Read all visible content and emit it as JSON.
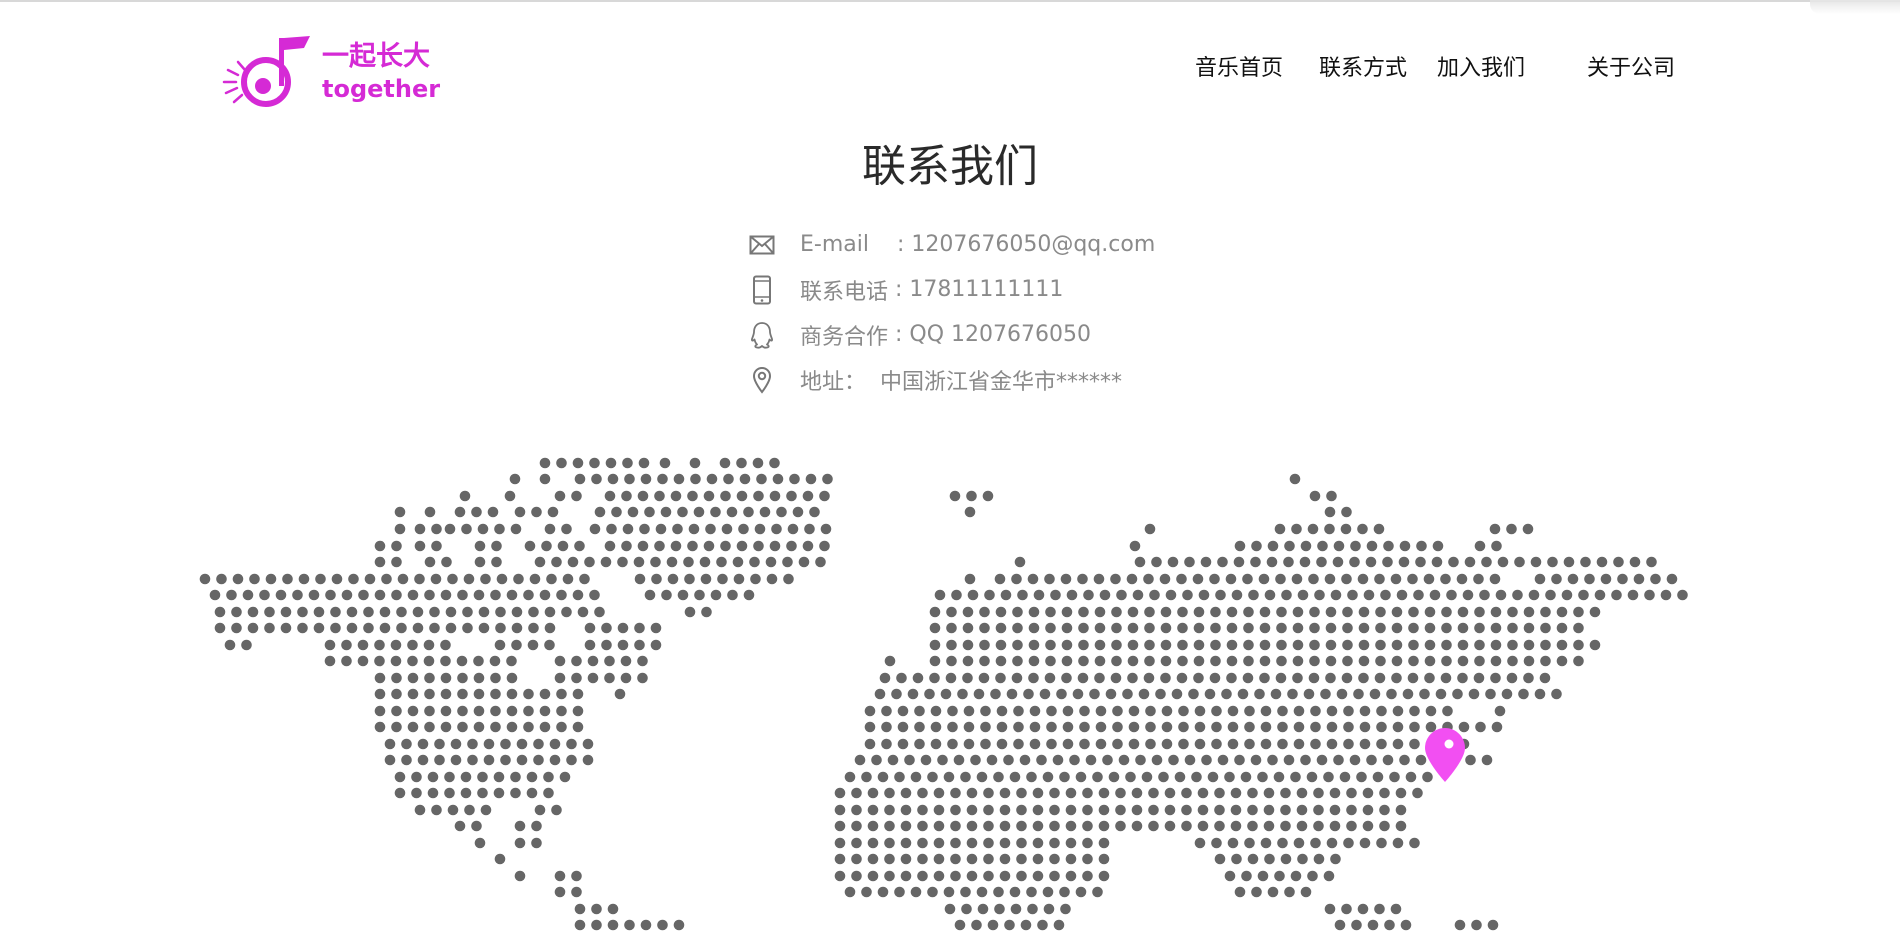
{
  "brand": {
    "name_cn": "一起长大",
    "name_en": "together",
    "color": "#d52ad5"
  },
  "nav": {
    "items": [
      {
        "label": "音乐首页"
      },
      {
        "label": "联系方式"
      },
      {
        "label": "加入我们"
      },
      {
        "label": "关于公司"
      }
    ]
  },
  "page": {
    "title": "联系我们"
  },
  "contacts": [
    {
      "icon": "mail-icon",
      "label": "E-mail",
      "sep": "    : ",
      "value": "1207676050@qq.com"
    },
    {
      "icon": "phone-icon",
      "label": "联系电话",
      "sep": " : ",
      "value": "17811111111"
    },
    {
      "icon": "qq-icon",
      "label": "商务合作",
      "sep": " : ",
      "value": "QQ 1207676050"
    },
    {
      "icon": "location-pin-icon",
      "label": "地址：",
      "sep": "  ",
      "value": "中国浙江省金华市******"
    }
  ],
  "map": {
    "dot_color": "#666666",
    "marker_color": "#f24ff2",
    "marker_icon": "map-marker-icon"
  }
}
